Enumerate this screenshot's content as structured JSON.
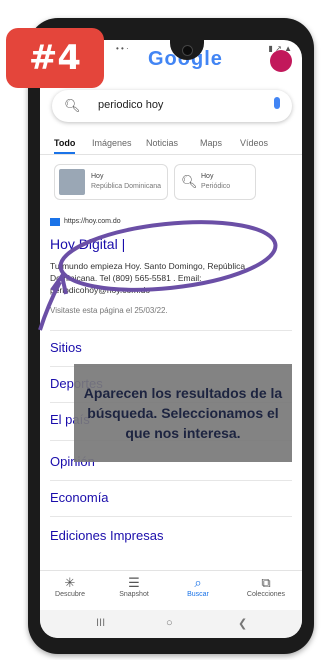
{
  "badge": "#4",
  "status": {
    "left": "• • ·",
    "right": "▮ ↗ ▲"
  },
  "google_logo": "Google",
  "search": {
    "query": "periodico hoy"
  },
  "tabs": [
    "Todo",
    "Imágenes",
    "Noticias",
    "Maps",
    "Vídeos"
  ],
  "suggestions": [
    {
      "line1": "Hoy",
      "line2": "República Dominicana"
    },
    {
      "line1": "Hoy",
      "line2": "Periódico"
    }
  ],
  "result": {
    "url": "https://hoy.com.do",
    "title": "Hoy Digital |",
    "snippet": "Tu mundo empieza Hoy. Santo Domingo, República Dominicana. Tel (809) 565-5581 . Email: periodicohoy@hoy.com.do",
    "visited": "Visitaste esta página el 25/03/22."
  },
  "sitelinks": [
    "Sitios",
    "Deportes",
    "El país",
    "Opinión",
    "Economía",
    "Ediciones Impresas"
  ],
  "overlay_text": "Aparecen los resultados de la búsqueda. Seleccionamos el que nos interesa.",
  "bottom_nav": [
    {
      "icon": "✳",
      "label": "Descubre"
    },
    {
      "icon": "☰",
      "label": "Snapshot"
    },
    {
      "icon": "⌕",
      "label": "Buscar"
    },
    {
      "icon": "⧉",
      "label": "Colecciones"
    }
  ],
  "system_nav": [
    "III",
    "○",
    "❮"
  ],
  "colors": {
    "badge": "#e4453b",
    "annotation": "#6b4fa6",
    "link": "#1a0dab",
    "accent": "#1a73e8"
  }
}
